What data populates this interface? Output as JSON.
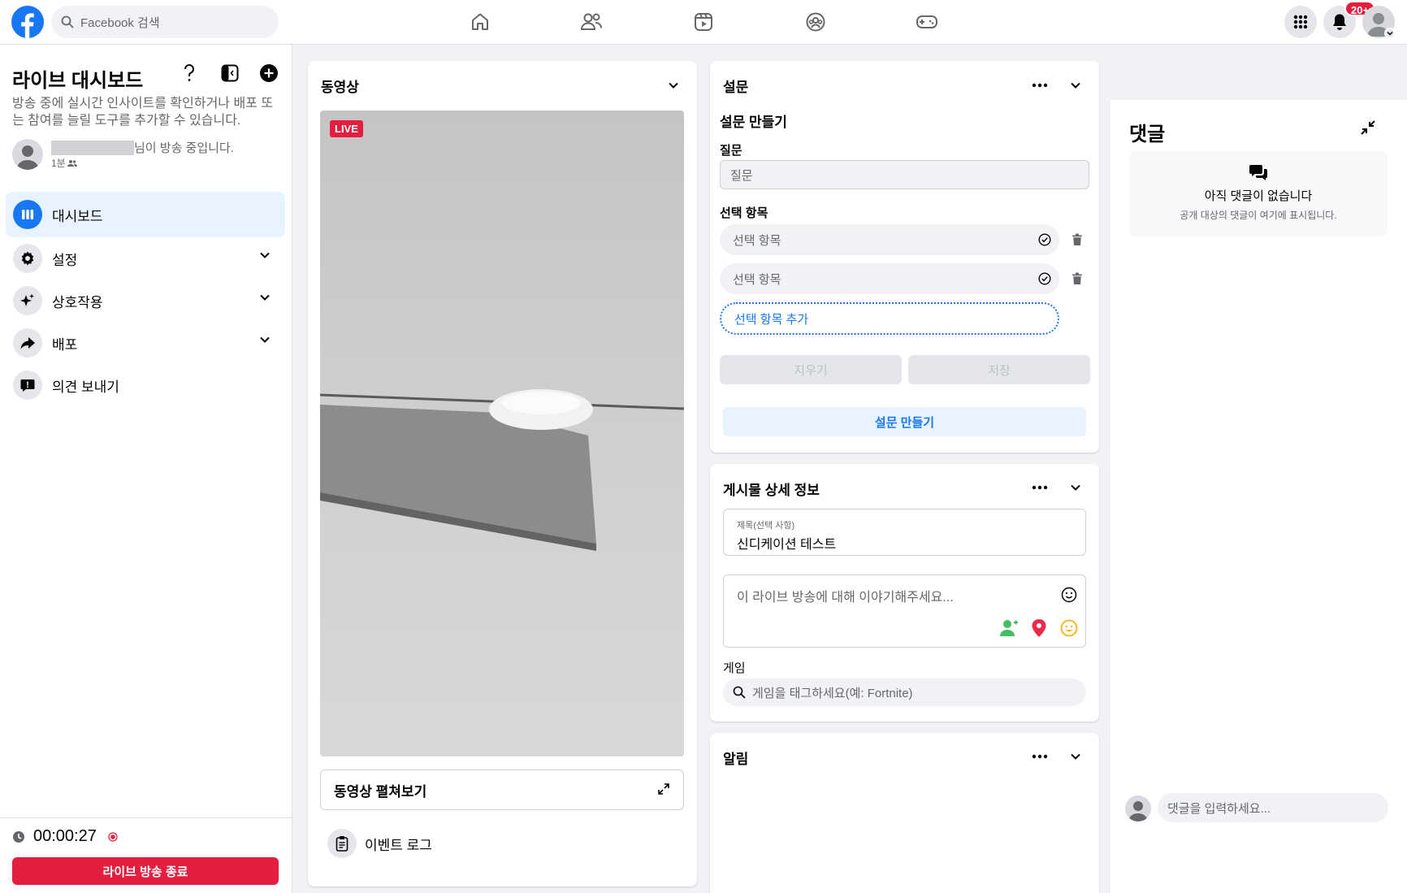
{
  "topbar": {
    "search_placeholder": "Facebook 검색",
    "notification_count": "20+"
  },
  "sidebar": {
    "title": "라이브 대시보드",
    "description": "방송 중에 실시간 인사이트를 확인하거나 배포 또는 참여를 늘릴 도구를 추가할 수 있습니다.",
    "host_text": "님이 방송 중입니다.",
    "host_meta": "1분",
    "items": [
      {
        "label": "대시보드",
        "icon": "dashboard-icon",
        "active": true
      },
      {
        "label": "설정",
        "icon": "gear-icon"
      },
      {
        "label": "상호작용",
        "icon": "sparkle-icon"
      },
      {
        "label": "배포",
        "icon": "share-icon"
      },
      {
        "label": "의견 보내기",
        "icon": "feedback-icon"
      }
    ],
    "timer": "00:00:27",
    "end_button": "라이브 방송 종료"
  },
  "video_panel": {
    "title": "동영상",
    "live_badge": "LIVE",
    "expand_label": "동영상 펼쳐보기",
    "event_log": "이벤트 로그"
  },
  "poll_panel": {
    "title": "설문",
    "create_title": "설문 만들기",
    "question_label": "질문",
    "question_placeholder": "질문",
    "options_label": "선택 항목",
    "option_placeholder_1": "선택 항목",
    "option_placeholder_2": "선택 항목",
    "add_option": "선택 항목 추가",
    "clear_button": "지우기",
    "save_button": "저장",
    "create_button": "설문 만들기"
  },
  "post_panel": {
    "title": "게시물 상세 정보",
    "title_field_label": "제목(선택 사항)",
    "title_field_value": "신디케이션 테스트",
    "description_placeholder": "이 라이브 방송에 대해 이야기해주세요...",
    "game_label": "게임",
    "game_placeholder": "게임을 태그하세요(예: Fortnite)"
  },
  "alerts_panel": {
    "title": "알림"
  },
  "comments": {
    "title": "댓글",
    "empty_title": "아직 댓글이 없습니다",
    "empty_sub": "공개 대상의 댓글이 여기에 표시됩니다.",
    "input_placeholder": "댓글을 입력하세요..."
  },
  "colors": {
    "brand": "#1877f2",
    "live_red": "#e41e3f"
  }
}
